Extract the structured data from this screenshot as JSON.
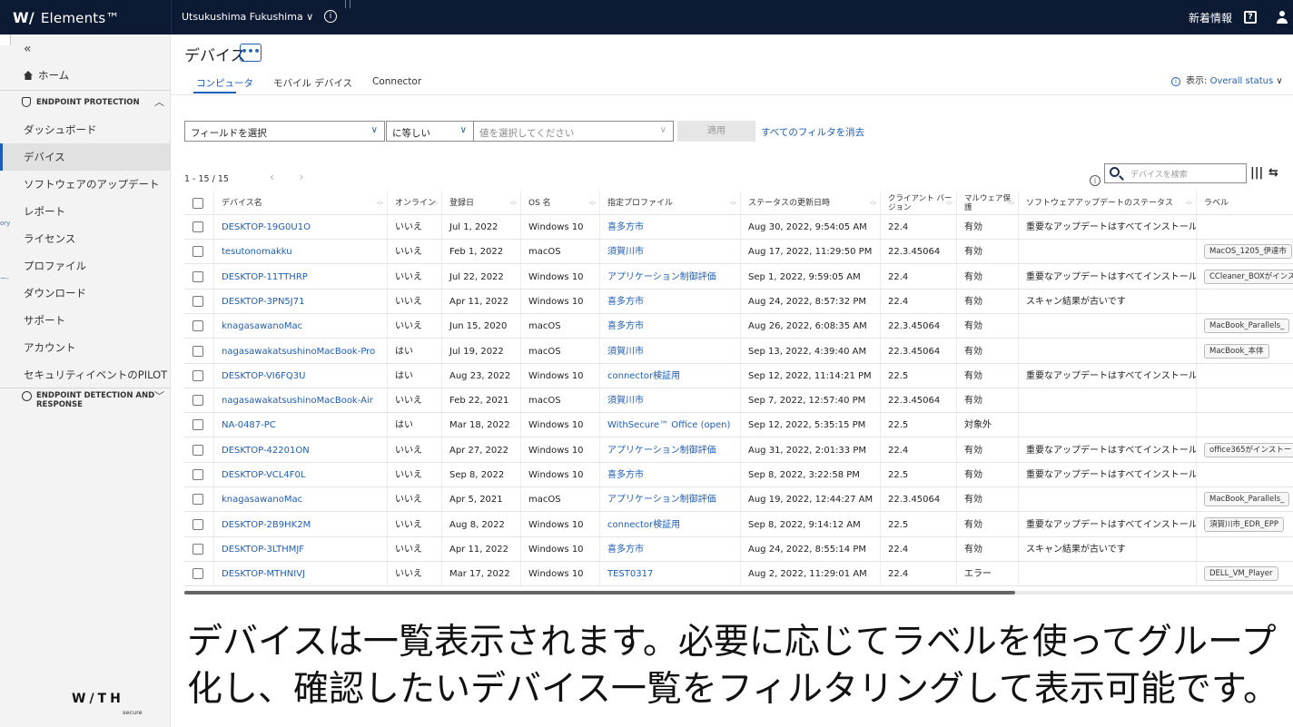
{
  "topbar": {
    "logo_mark": "W/",
    "logo_text": "Elements™",
    "org": "Utsukushima Fukushima ∨",
    "info_icon": "ⓘ",
    "news": "新着情報",
    "help_icon": "?"
  },
  "sidebar": {
    "collapse": "«",
    "home": "ホーム",
    "ep_section": "ENDPOINT PROTECTION",
    "items": [
      "ダッシュボード",
      "デバイス",
      "ソフトウェアのアップデート",
      "レポート",
      "ライセンス",
      "プロファイル",
      "ダウンロード",
      "サポート",
      "アカウント",
      "セキュリティイベントのPILOT"
    ],
    "edr_section_1": "ENDPOINT DETECTION AND",
    "edr_section_2": "RESPONSE",
    "edge_text_1": "ory",
    "edge_text_2": "ー-",
    "footer_logo": "W/TH",
    "footer_sub": "secure"
  },
  "main": {
    "title": "デバイス",
    "more": "•••",
    "tabs": [
      "コンピュータ",
      "モバイル デバイス",
      "Connector"
    ],
    "view_label": "表示: ",
    "view_value": "Overall status",
    "view_chev": "∨"
  },
  "filters": {
    "field": "フィールドを選択",
    "operator": "に等しい",
    "value_placeholder": "値を選択してください",
    "apply": "適用",
    "clear": "すべてのフィルタを消去"
  },
  "table": {
    "count": "1 - 15 / 15",
    "pager": "‹ ›",
    "search_placeholder": "デバイスを検索",
    "col_icon": "|||",
    "filter_icon": "⇆",
    "headers": [
      "デバイス名",
      "オンライン",
      "登録日",
      "OS 名",
      "指定プロファイル",
      "ステータスの更新日時",
      "クライアント バージョン",
      "マルウェア保護",
      "ソフトウェアアップデートのステータス",
      "ラベル"
    ],
    "header_two_line": {
      "client_1": "クライアント バー",
      "client_2": "ジョン",
      "malware_1": "マルウェア保",
      "malware_2": "護"
    },
    "rows": [
      {
        "name": "DESKTOP-19G0U1O",
        "online": "いいえ",
        "reg": "Jul 1, 2022",
        "os": "Windows 10",
        "profile": "喜多方市",
        "updated": "Aug 30, 2022, 9:54:05 AM",
        "client": "22.4",
        "malware": "有効",
        "sw": "重要なアップデートはすべてインストール済み",
        "label": ""
      },
      {
        "name": "tesutonomakku",
        "online": "いいえ",
        "reg": "Feb 1, 2022",
        "os": "macOS",
        "profile": "須賀川市",
        "updated": "Aug 17, 2022, 11:29:50 PM",
        "client": "22.3.45064",
        "malware": "有効",
        "sw": "",
        "label": "MacOS_1205_伊達市"
      },
      {
        "name": "DESKTOP-11TTHRP",
        "online": "いいえ",
        "reg": "Jul 22, 2022",
        "os": "Windows 10",
        "profile": "アプリケーション制御評価",
        "updated": "Sep 1, 2022, 9:59:05 AM",
        "client": "22.4",
        "malware": "有効",
        "sw": "重要なアップデートはすべてインストール済み",
        "label": "CCleaner_BOXがインス"
      },
      {
        "name": "DESKTOP-3PN5J71",
        "online": "いいえ",
        "reg": "Apr 11, 2022",
        "os": "Windows 10",
        "profile": "喜多方市",
        "updated": "Aug 24, 2022, 8:57:32 PM",
        "client": "22.4",
        "malware": "有効",
        "sw": "スキャン結果が古いです",
        "label": ""
      },
      {
        "name": "knagasawanoMac",
        "online": "いいえ",
        "reg": "Jun 15, 2020",
        "os": "macOS",
        "profile": "喜多方市",
        "updated": "Aug 26, 2022, 6:08:35 AM",
        "client": "22.3.45064",
        "malware": "有効",
        "sw": "",
        "label": "MacBook_Parallels_"
      },
      {
        "name": "nagasawakatsushinoMacBook-Pro",
        "online": "はい",
        "reg": "Jul 19, 2022",
        "os": "macOS",
        "profile": "須賀川市",
        "updated": "Sep 13, 2022, 4:39:40 AM",
        "client": "22.3.45064",
        "malware": "有効",
        "sw": "",
        "label": "MacBook_本体"
      },
      {
        "name": "DESKTOP-VI6FQ3U",
        "online": "はい",
        "reg": "Aug 23, 2022",
        "os": "Windows 10",
        "profile": "connector検証用",
        "updated": "Sep 12, 2022, 11:14:21 PM",
        "client": "22.5",
        "malware": "有効",
        "sw": "重要なアップデートはすべてインストール済み",
        "label": ""
      },
      {
        "name": "nagasawakatsushinoMacBook-Air",
        "online": "いいえ",
        "reg": "Feb 22, 2021",
        "os": "macOS",
        "profile": "須賀川市",
        "updated": "Sep 7, 2022, 12:57:40 PM",
        "client": "22.3.45064",
        "malware": "有効",
        "sw": "",
        "label": ""
      },
      {
        "name": "NA-0487-PC",
        "online": "はい",
        "reg": "Mar 18, 2022",
        "os": "Windows 10",
        "profile": "WithSecure™ Office (open)",
        "updated": "Sep 12, 2022, 5:35:15 PM",
        "client": "22.5",
        "malware": "対象外",
        "sw": "",
        "label": ""
      },
      {
        "name": "DESKTOP-42201ON",
        "online": "いいえ",
        "reg": "Apr 27, 2022",
        "os": "Windows 10",
        "profile": "アプリケーション制御評価",
        "updated": "Aug 31, 2022, 2:01:33 PM",
        "client": "22.4",
        "malware": "有効",
        "sw": "重要なアップデートはすべてインストール済み",
        "label": "office365がインストー"
      },
      {
        "name": "DESKTOP-VCL4F0L",
        "online": "いいえ",
        "reg": "Sep 8, 2022",
        "os": "Windows 10",
        "profile": "喜多方市",
        "updated": "Sep 8, 2022, 3:22:58 PM",
        "client": "22.5",
        "malware": "有効",
        "sw": "重要なアップデートはすべてインストール済み",
        "label": ""
      },
      {
        "name": "knagasawanoMac",
        "online": "いいえ",
        "reg": "Apr 5, 2021",
        "os": "macOS",
        "profile": "アプリケーション制御評価",
        "updated": "Aug 19, 2022, 12:44:27 AM",
        "client": "22.3.45064",
        "malware": "有効",
        "sw": "",
        "label": "MacBook_Parallels_"
      },
      {
        "name": "DESKTOP-2B9HK2M",
        "online": "いいえ",
        "reg": "Aug 8, 2022",
        "os": "Windows 10",
        "profile": "connector検証用",
        "updated": "Sep 8, 2022, 9:14:12 AM",
        "client": "22.5",
        "malware": "有効",
        "sw": "重要なアップデートはすべてインストール済み",
        "label": "須賀川市_EDR_EPP"
      },
      {
        "name": "DESKTOP-3LTHMJF",
        "online": "いいえ",
        "reg": "Apr 11, 2022",
        "os": "Windows 10",
        "profile": "喜多方市",
        "updated": "Aug 24, 2022, 8:55:14 PM",
        "client": "22.4",
        "malware": "有効",
        "sw": "スキャン結果が古いです",
        "label": ""
      },
      {
        "name": "DESKTOP-MTHNIVJ",
        "online": "いいえ",
        "reg": "Mar 17, 2022",
        "os": "Windows 10",
        "profile": "TEST0317",
        "updated": "Aug 2, 2022, 11:29:01 AM",
        "client": "22.4",
        "malware": "エラー",
        "sw": "",
        "label": "DELL_VM_Player"
      }
    ]
  },
  "caption": "デバイスは一覧表示されます。必要に応じてラベルを使ってグループ化し、確認したいデバイス一覧をフィルタリングして表示可能です。",
  "colors": {
    "topbar": "#0c1a33",
    "accent": "#1e5db8",
    "sidebar": "#f3f3f3"
  }
}
